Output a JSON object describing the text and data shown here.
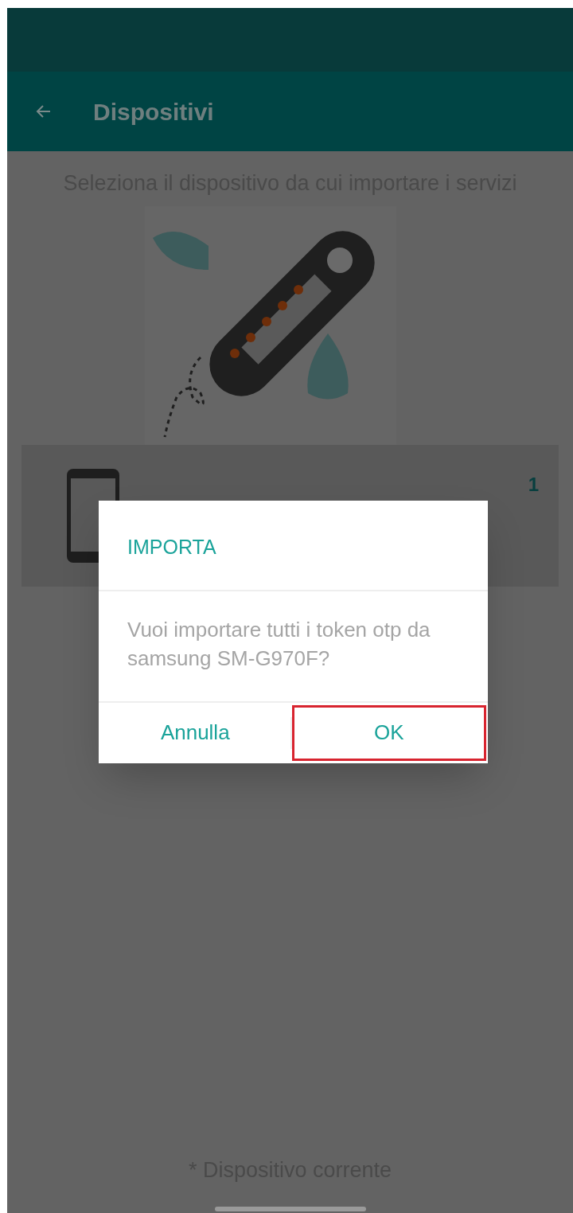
{
  "app_bar": {
    "title": "Dispositivi"
  },
  "instruction": "Seleziona il dispositivo da cui importare i servizi",
  "devices": [
    {
      "count": "1"
    }
  ],
  "dialog": {
    "title": "IMPORTA",
    "message": "Vuoi importare tutti i token otp da samsung SM-G970F?",
    "buttons": [
      {
        "label": "Annulla",
        "highlighted": false
      },
      {
        "label": "OK",
        "highlighted": true
      }
    ]
  },
  "footnote": "* Dispositivo corrente"
}
